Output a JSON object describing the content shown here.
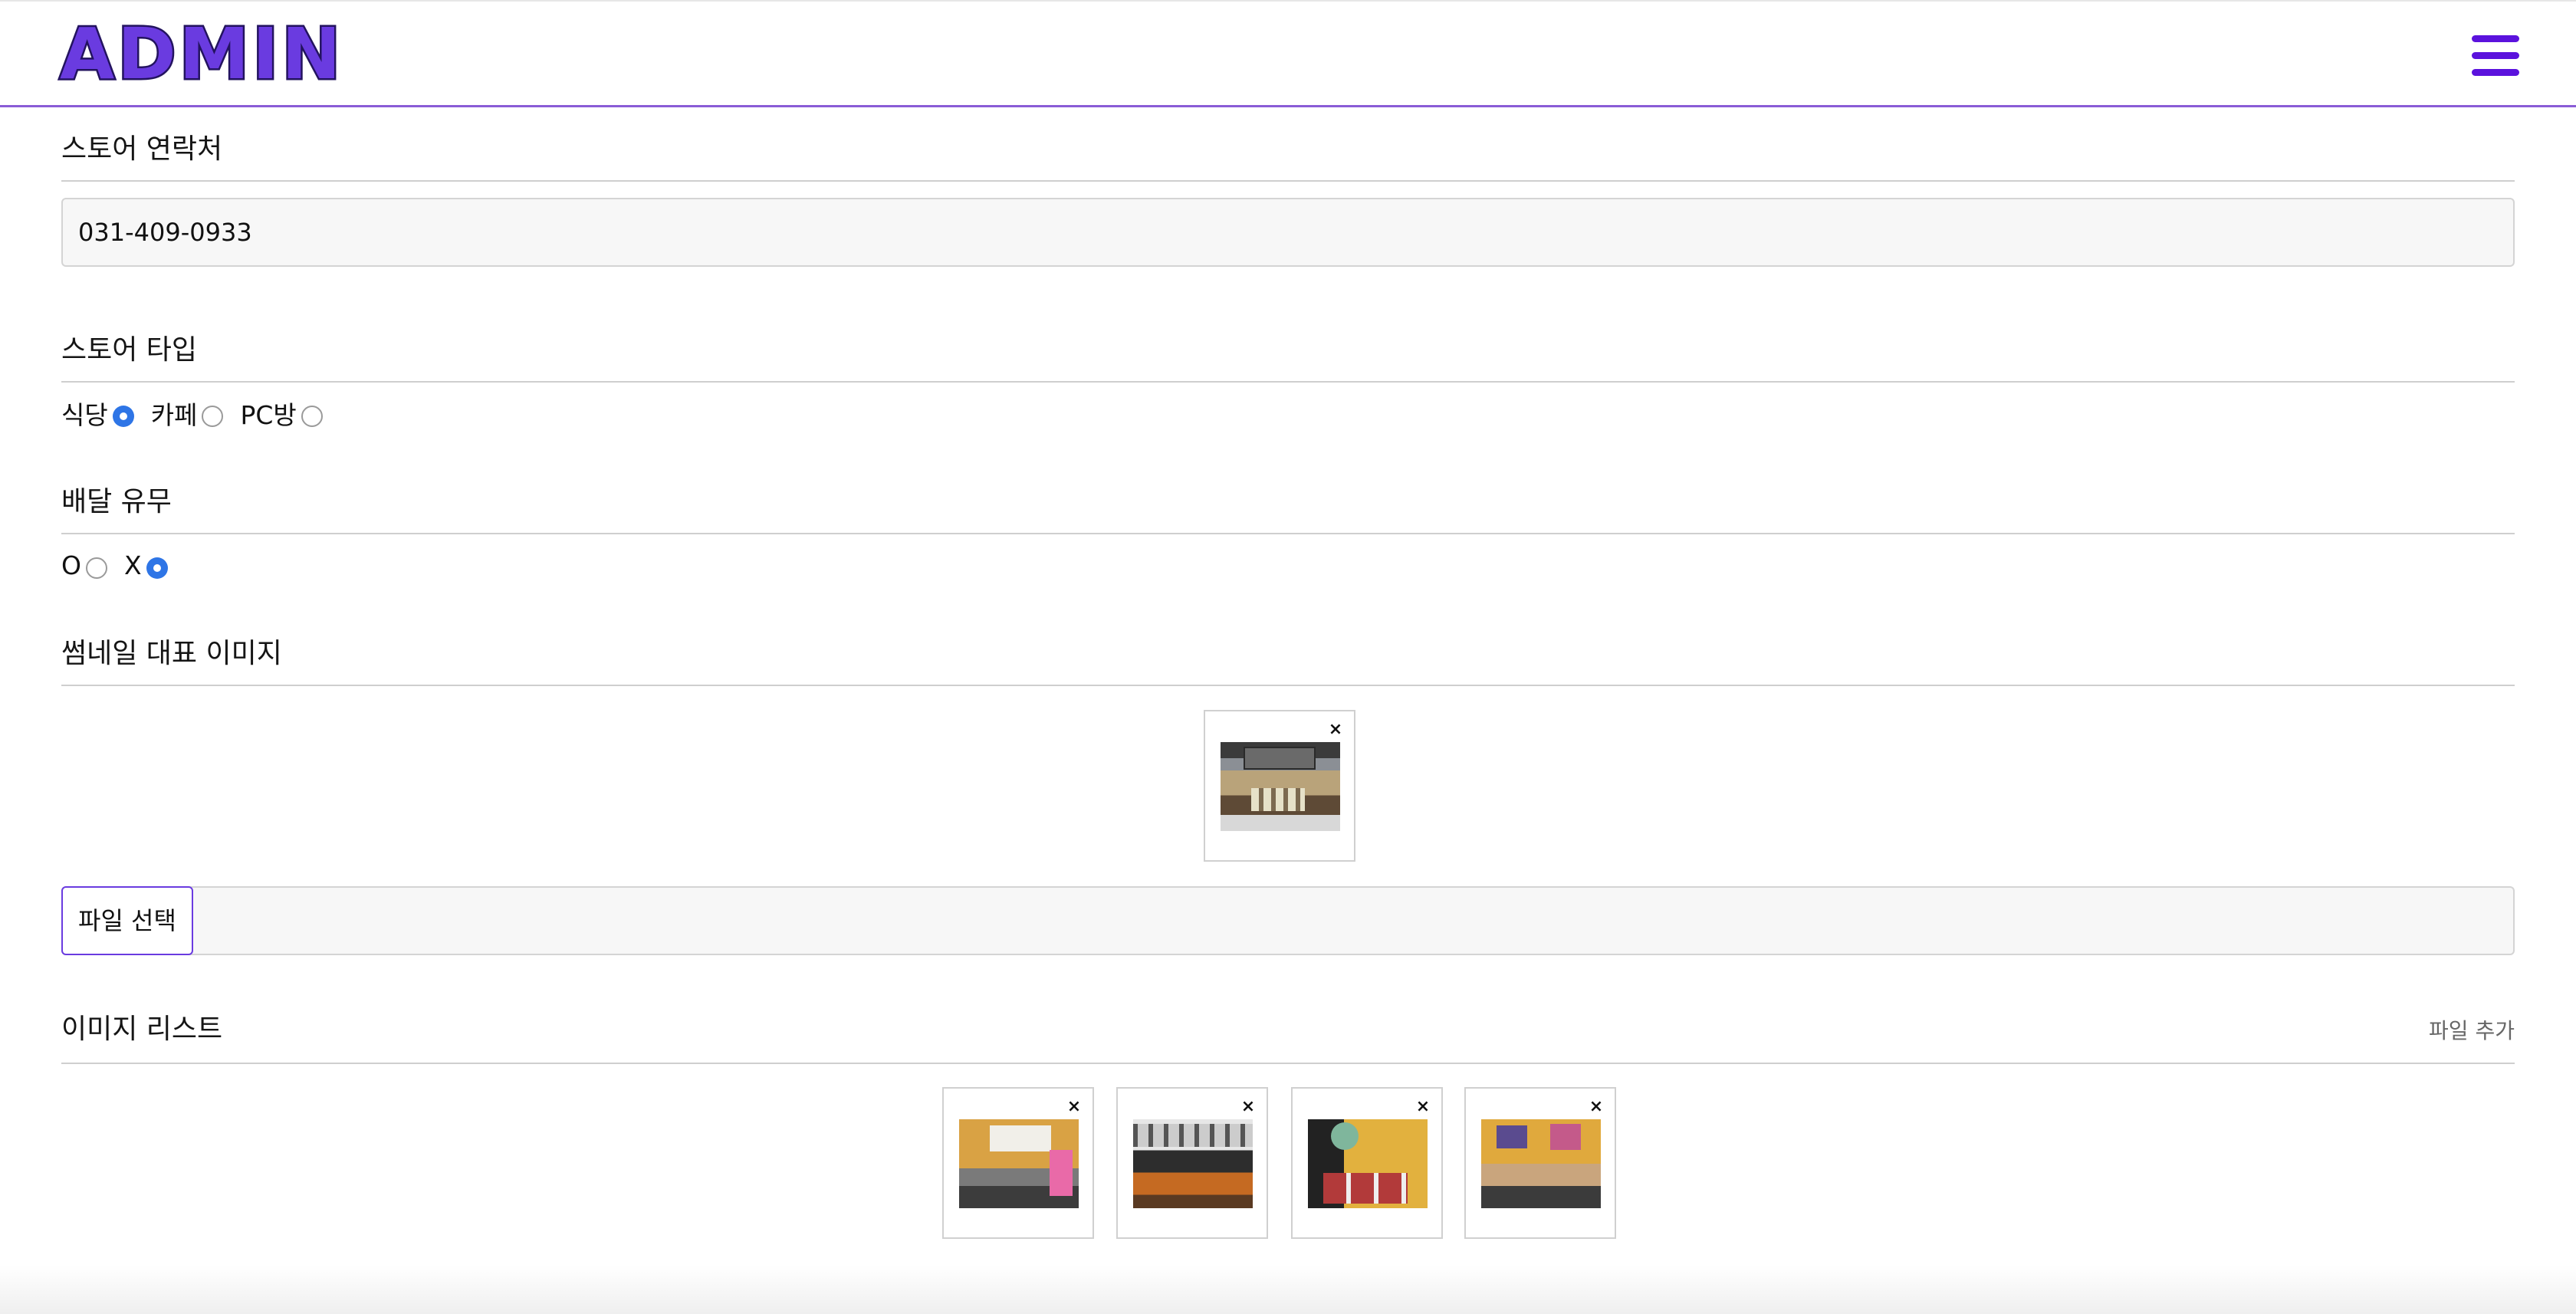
{
  "header": {
    "logo": "ADMIN",
    "menu_icon": "hamburger-menu-icon"
  },
  "contact": {
    "title": "스토어 연락처",
    "value": "031-409-0933"
  },
  "store_type": {
    "title": "스토어 타입",
    "options": [
      {
        "label": "식당",
        "checked": true
      },
      {
        "label": "카페",
        "checked": false
      },
      {
        "label": "PC방",
        "checked": false
      }
    ]
  },
  "delivery": {
    "title": "배달 유무",
    "options": [
      {
        "label": "O",
        "checked": false
      },
      {
        "label": "X",
        "checked": true
      }
    ]
  },
  "thumbnail": {
    "title": "썸네일 대표 이미지",
    "remove_label": "×",
    "file_button": "파일 선택"
  },
  "image_list": {
    "title": "이미지 리스트",
    "add_file": "파일 추가",
    "remove_label": "×"
  },
  "colors": {
    "accent": "#6a3be0",
    "menu": "#5b12dd",
    "radio_checked": "#2e75e6"
  }
}
